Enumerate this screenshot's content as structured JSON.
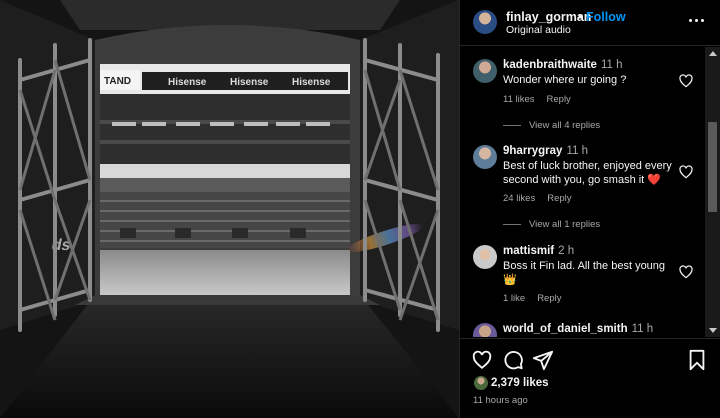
{
  "post": {
    "username": "finlay_gorman",
    "follow_label": "Follow",
    "separator": "•",
    "audio": "Original audio",
    "more_icon": "more-horizontal-icon"
  },
  "media": {
    "signage": [
      "TAND",
      "Hisense",
      "Hisense",
      "Hisense"
    ],
    "floor_text": "ds"
  },
  "comments": [
    {
      "user": "kadenbraithwaite",
      "time": "11 h",
      "text": "Wonder where ur going ?",
      "likes": "11 likes",
      "reply": "Reply",
      "view_replies": "View all 4 replies"
    },
    {
      "user": "9harrygray",
      "time": "11 h",
      "text": "Best of luck brother, enjoyed every second with you, go smash it ❤️",
      "likes": "24 likes",
      "reply": "Reply",
      "view_replies": "View all 1 replies"
    },
    {
      "user": "mattismif",
      "time": "2 h",
      "text": "Boss it Fin lad. All the best young 👑",
      "likes": "1 like",
      "reply": "Reply"
    },
    {
      "user": "world_of_daniel_smith",
      "time": "11 h"
    }
  ],
  "actions": {
    "like_icon": "heart-icon",
    "comment_icon": "comment-icon",
    "share_icon": "send-icon",
    "save_icon": "bookmark-icon"
  },
  "likes_count": "2,379 likes",
  "posted_time": "11 hours ago",
  "colors": {
    "background": "#000000",
    "follow": "#0095f6",
    "muted": "#a8a8a8",
    "heart_red": "#ff3040"
  }
}
